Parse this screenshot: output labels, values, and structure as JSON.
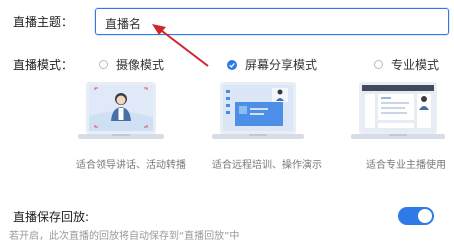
{
  "topic": {
    "label": "直播主题：",
    "value": "直播名"
  },
  "mode": {
    "label": "直播模式：",
    "options": [
      {
        "label": "摄像模式",
        "caption": "适合领导讲话、活动转播",
        "selected": false
      },
      {
        "label": "屏幕分享模式",
        "caption": "适合远程培训、操作演示",
        "selected": true
      },
      {
        "label": "专业模式",
        "caption": "适合专业主播使用",
        "selected": false
      }
    ]
  },
  "save_replay": {
    "label": "直播保存回放:",
    "hint": "若开启，此次直播的回放将自动保存到“直播回放”中",
    "enabled": true
  },
  "colors": {
    "accent": "#2e7ae6",
    "arrow": "#d0252a"
  }
}
